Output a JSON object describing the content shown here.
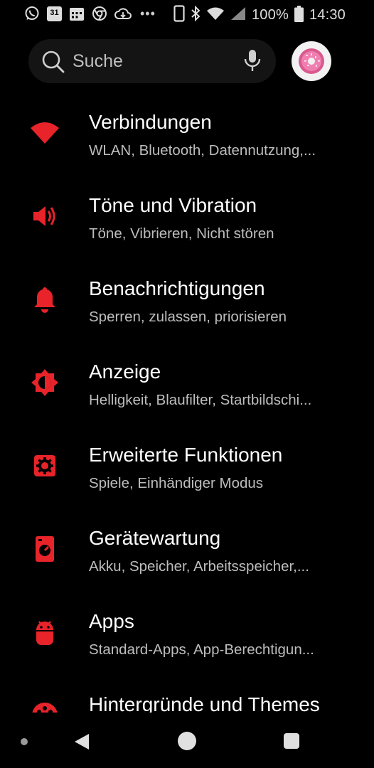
{
  "status_bar": {
    "battery": "100%",
    "time": "14:30",
    "calendar_day": "31",
    "icons": [
      "whatsapp-icon",
      "calendar-icon",
      "calendar-grid-icon",
      "chrome-icon",
      "cloud-sync-icon",
      "more-icon",
      "phone-outline-icon",
      "bluetooth-icon",
      "wifi-icon",
      "signal-icon",
      "battery-icon"
    ]
  },
  "search": {
    "placeholder": "Suche"
  },
  "settings": [
    {
      "title": "Verbindungen",
      "subtitle": "WLAN, Bluetooth, Datennutzung,...",
      "icon": "wifi-icon"
    },
    {
      "title": "Töne und Vibration",
      "subtitle": "Töne, Vibrieren, Nicht stören",
      "icon": "volume-icon"
    },
    {
      "title": "Benachrichtigungen",
      "subtitle": "Sperren, zulassen, priorisieren",
      "icon": "bell-icon"
    },
    {
      "title": "Anzeige",
      "subtitle": "Helligkeit, Blaufilter, Startbildschi...",
      "icon": "brightness-icon"
    },
    {
      "title": "Erweiterte Funktionen",
      "subtitle": "Spiele, Einhändiger Modus",
      "icon": "gear-icon"
    },
    {
      "title": "Gerätewartung",
      "subtitle": "Akku, Speicher, Arbeitsspeicher,...",
      "icon": "device-care-icon"
    },
    {
      "title": "Apps",
      "subtitle": "Standard-Apps, App-Berechtigun...",
      "icon": "android-icon"
    },
    {
      "title": "Hintergründe und Themes",
      "subtitle": "",
      "icon": "palette-icon"
    }
  ],
  "colors": {
    "accent": "#e8232a",
    "background": "#000000",
    "subtitle": "#bdbdbd",
    "search_bg": "#141414"
  },
  "nav": {
    "icons": [
      "nav-dot-icon",
      "back-icon",
      "home-icon",
      "recents-icon"
    ]
  }
}
